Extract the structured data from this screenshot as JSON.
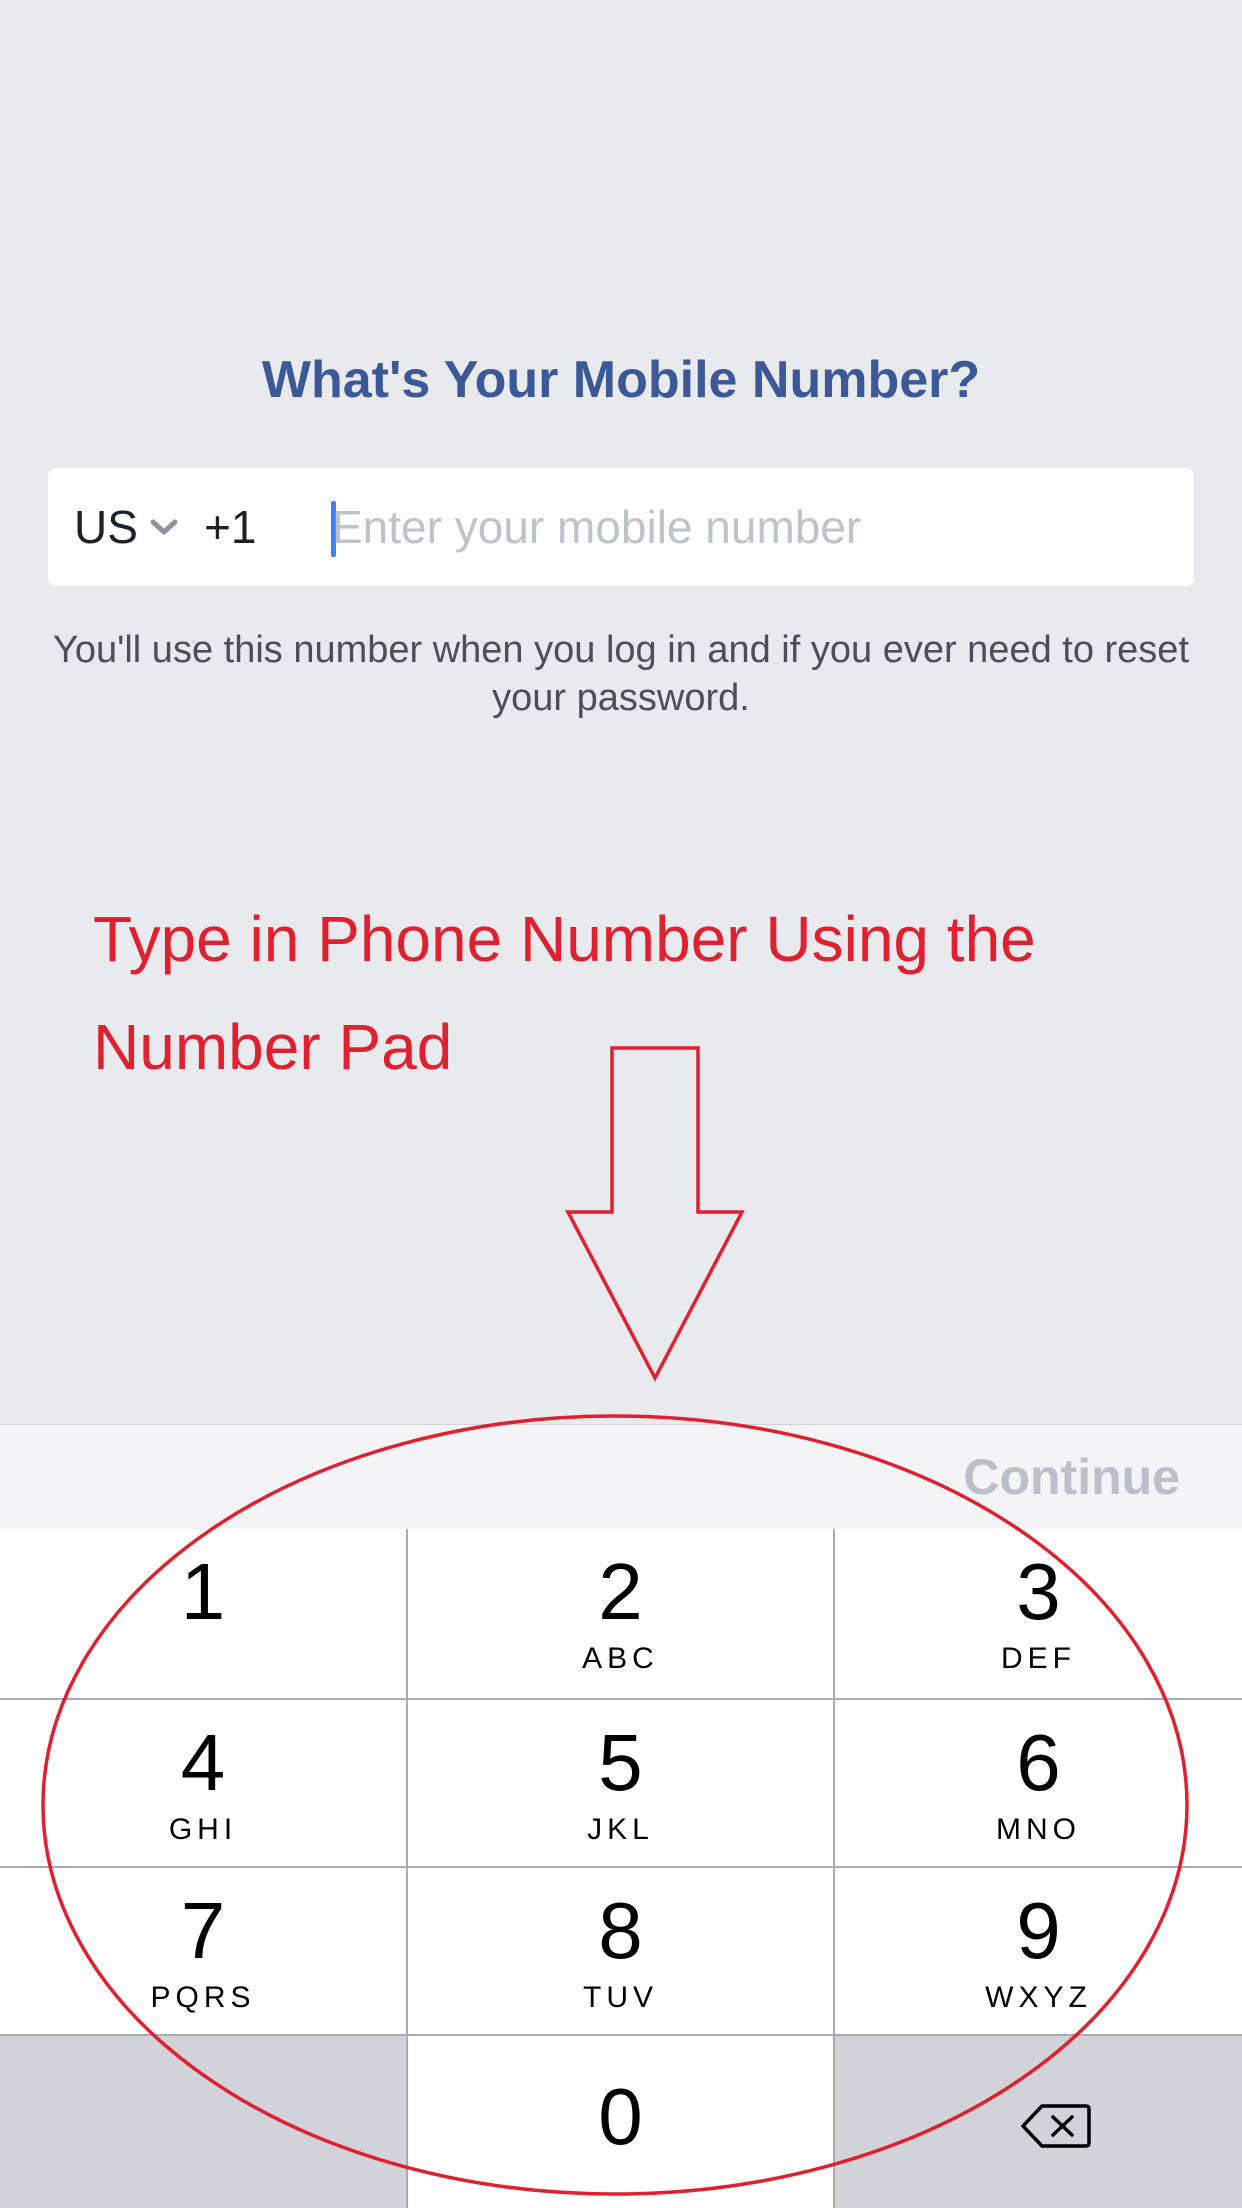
{
  "header": {
    "title": "What's Your Mobile Number?"
  },
  "phone": {
    "country": "US",
    "dial_code": "+1",
    "placeholder": "Enter your mobile number",
    "value": ""
  },
  "helper_text": "You'll use this number when you log in and if you ever need to reset your password.",
  "annotation": {
    "text": "Type in Phone Number Using the Number Pad",
    "color": "#e0202e"
  },
  "accessory": {
    "continue_label": "Continue"
  },
  "keypad": {
    "keys": [
      {
        "digit": "1",
        "letters": ""
      },
      {
        "digit": "2",
        "letters": "ABC"
      },
      {
        "digit": "3",
        "letters": "DEF"
      },
      {
        "digit": "4",
        "letters": "GHI"
      },
      {
        "digit": "5",
        "letters": "JKL"
      },
      {
        "digit": "6",
        "letters": "MNO"
      },
      {
        "digit": "7",
        "letters": "PQRS"
      },
      {
        "digit": "8",
        "letters": "TUV"
      },
      {
        "digit": "9",
        "letters": "WXYZ"
      },
      {
        "digit": "0",
        "letters": ""
      }
    ],
    "delete_icon": "backspace-icon"
  },
  "colors": {
    "title": "#3b5998",
    "caret": "#4080ff",
    "annotation": "#e0202e"
  }
}
